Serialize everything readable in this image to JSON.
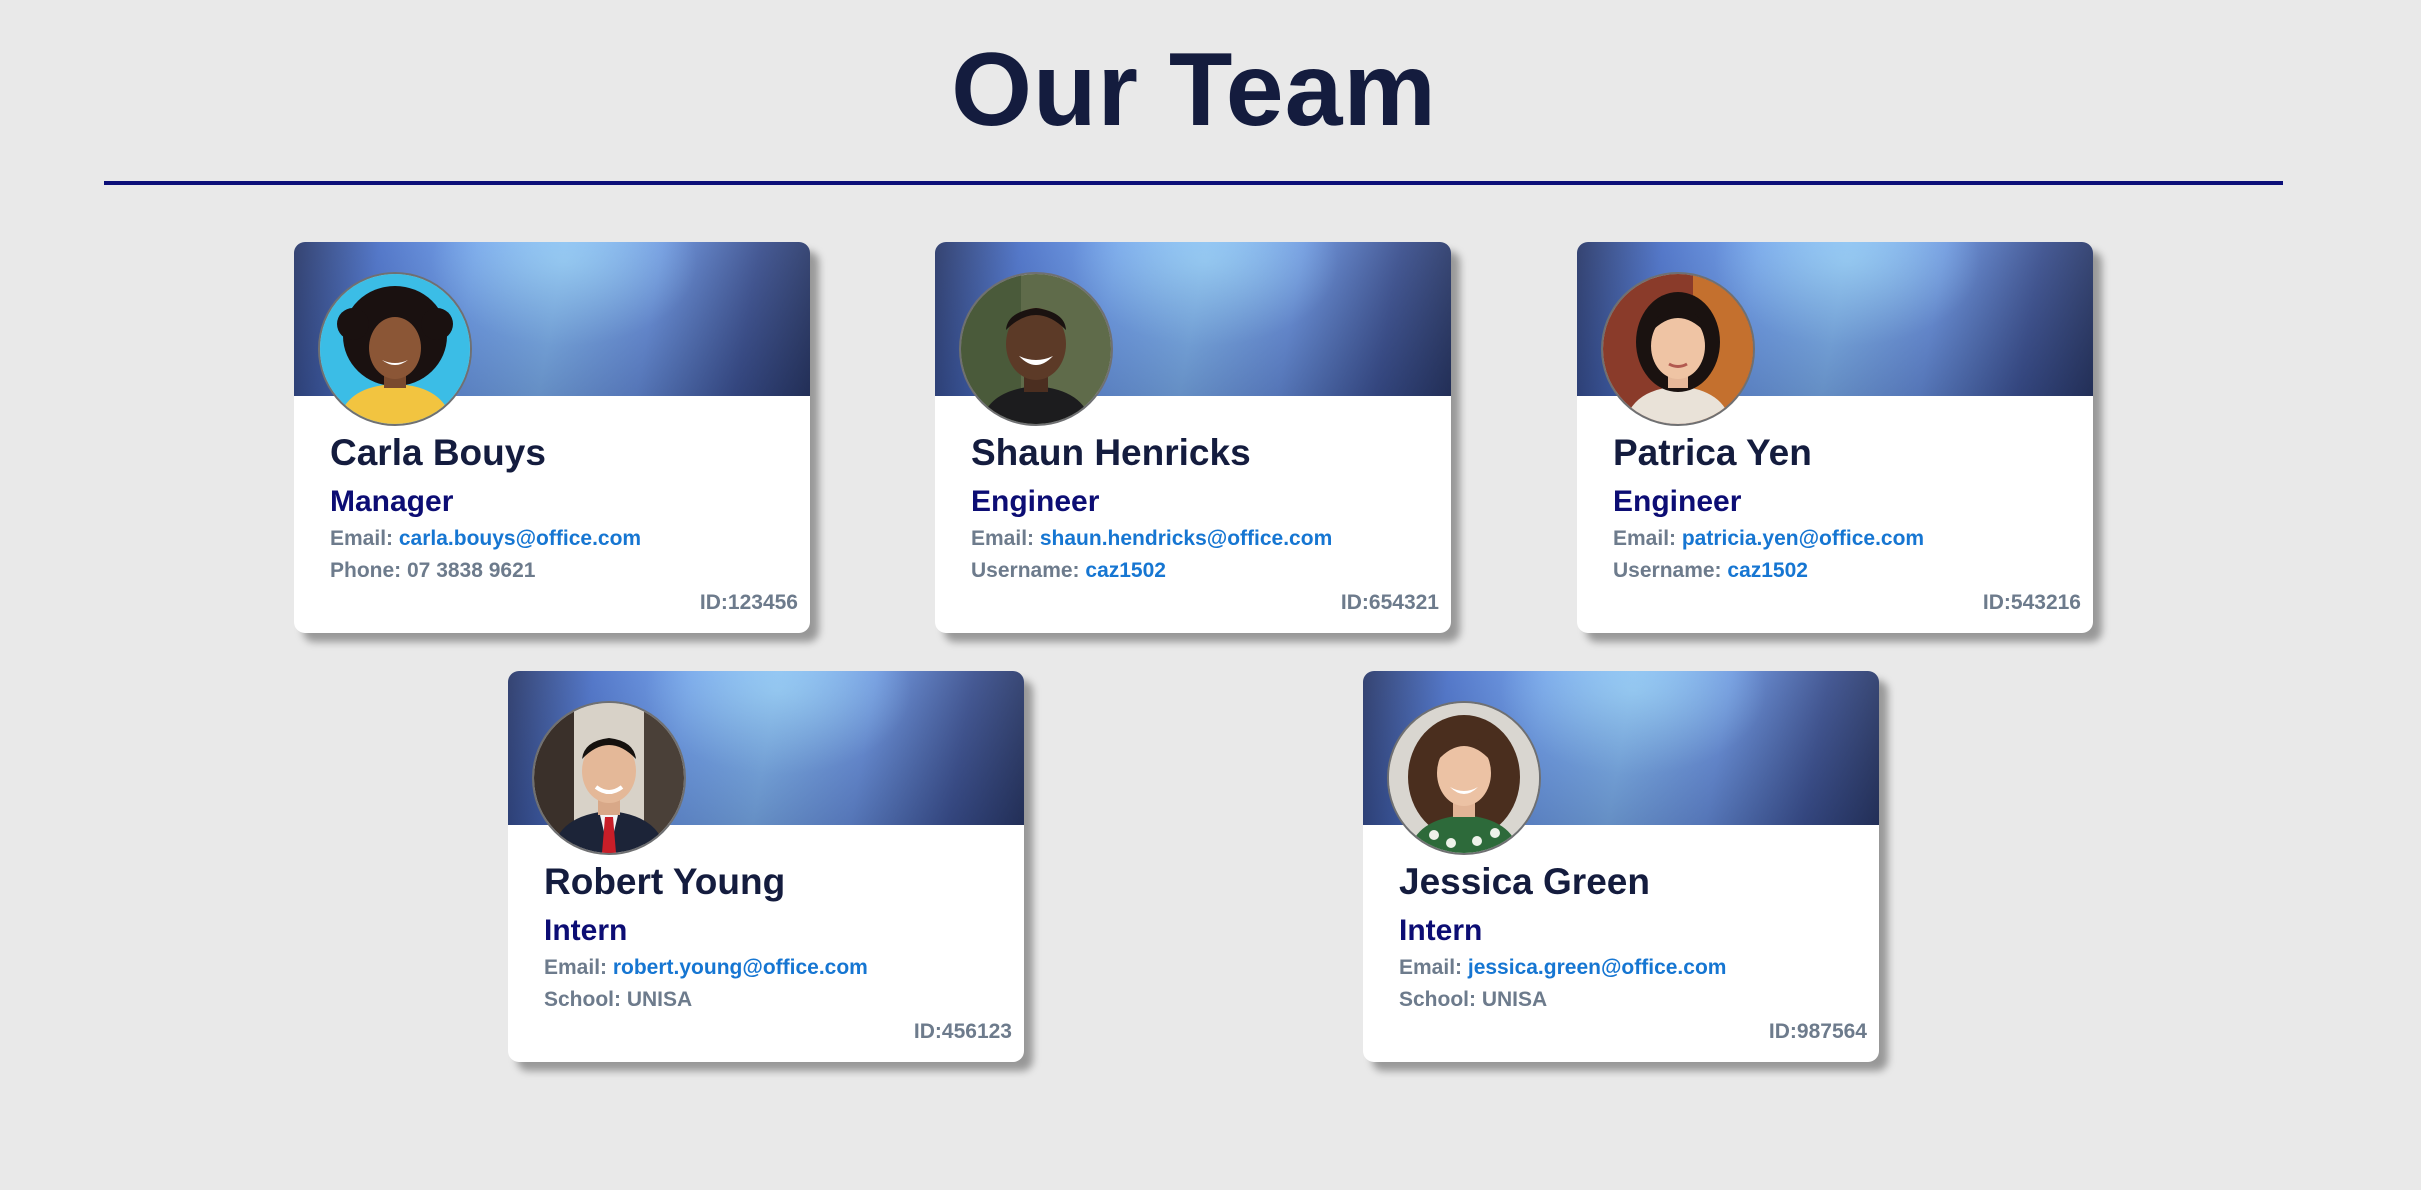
{
  "page": {
    "title": "Our Team"
  },
  "colors": {
    "background": "#e9e9e9",
    "title": "#141c3e",
    "rule": "#0c0f78",
    "role": "#0c0d74",
    "label": "#6d7b8c",
    "link": "#1676d2"
  },
  "members": [
    {
      "name": "Carla Bouys",
      "role": "Manager",
      "line1": {
        "label": "Email: ",
        "value": "carla.bouys@office.com"
      },
      "line2": {
        "label": "Phone: ",
        "value": "07 3838 9621"
      },
      "id": "ID:123456"
    },
    {
      "name": "Shaun Henricks",
      "role": "Engineer",
      "line1": {
        "label": "Email: ",
        "value": "shaun.hendricks@office.com"
      },
      "line2": {
        "label": "Username: ",
        "value": "caz1502"
      },
      "id": "ID:654321"
    },
    {
      "name": "Patrica Yen",
      "role": "Engineer",
      "line1": {
        "label": "Email: ",
        "value": "patricia.yen@office.com"
      },
      "line2": {
        "label": "Username: ",
        "value": "caz1502"
      },
      "id": "ID:543216"
    },
    {
      "name": "Robert Young",
      "role": "Intern",
      "line1": {
        "label": "Email: ",
        "value": "robert.young@office.com"
      },
      "line2": {
        "label": "School: ",
        "value": "UNISA"
      },
      "id": "ID:456123"
    },
    {
      "name": "Jessica Green",
      "role": "Intern",
      "line1": {
        "label": "Email: ",
        "value": "jessica.green@office.com"
      },
      "line2": {
        "label": "School: ",
        "value": "UNISA"
      },
      "id": "ID:987564"
    }
  ]
}
